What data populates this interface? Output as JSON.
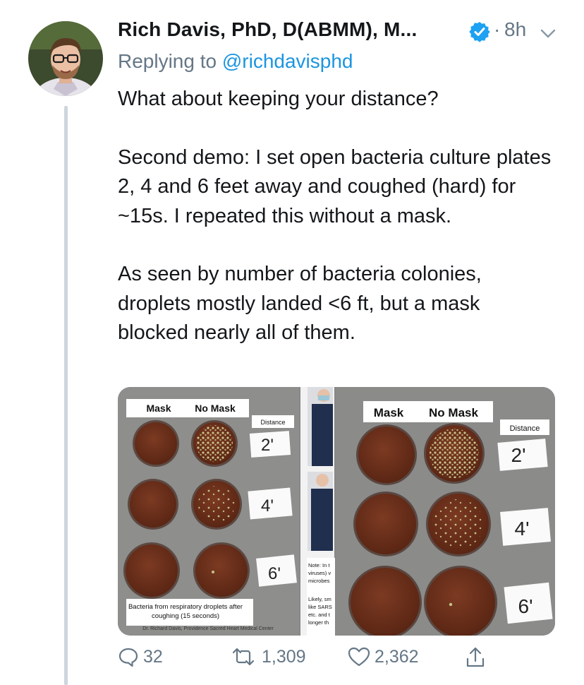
{
  "tweet": {
    "author_name": "Rich Davis, PhD, D(ABMM), M...",
    "separator": "·",
    "timestamp": "8h",
    "replying_prefix": "Replying to",
    "replying_handle": "@richdavisphd",
    "paragraphs": [
      "What about keeping your distance?",
      "Second demo: I set open bacteria culture plates 2, 4 and 6 feet away and coughed (hard) for ~15s. I repeated this without a mask.",
      "As seen by number of bacteria colonies, droplets mostly landed <6 ft, but a mask blocked nearly all of them."
    ]
  },
  "media": {
    "left_panel": {
      "header_mask": "Mask",
      "header_no_mask": "No Mask",
      "distance_label": "Distance",
      "dist_2": "2'",
      "dist_4": "4'",
      "dist_6": "6'",
      "caption_line1": "Bacteria from respiratory droplets after",
      "caption_line2": "coughing (15 seconds)",
      "credit": "Dr. Richard Davis, Providence Sacred Heart Medical Center"
    },
    "middle_strip": {
      "note_lines": [
        "Note: In t",
        "viruses) v",
        "microbes",
        "",
        "Likely, sm",
        "like SARS",
        "etc. and t",
        "longer th"
      ]
    },
    "right_panel": {
      "header_mask": "Mask",
      "header_no_mask": "No Mask",
      "distance_label": "Distance",
      "dist_2": "2'",
      "dist_4": "4'",
      "dist_6": "6'"
    }
  },
  "actions": {
    "replies": "32",
    "retweets": "1,309",
    "likes": "2,362"
  },
  "colors": {
    "link": "#1b95e0",
    "secondary_text": "#657786",
    "verified": "#1da1f2",
    "thread_line": "#cdd6dd",
    "agar": "#6b2f1c"
  }
}
